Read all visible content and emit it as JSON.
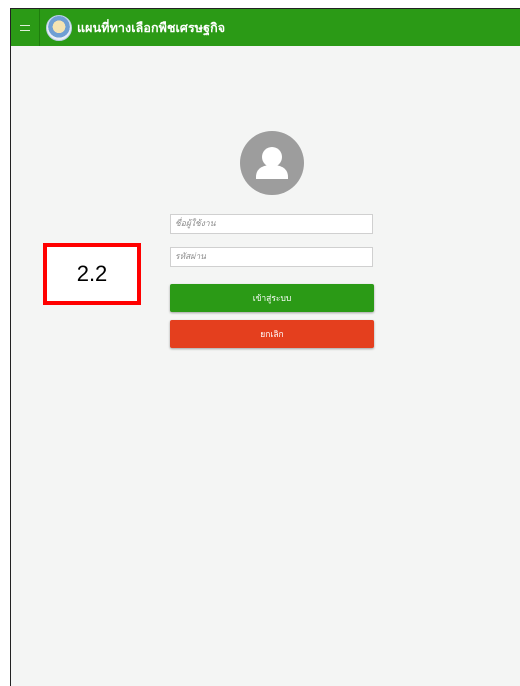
{
  "app": {
    "title": "แผนที่ทางเลือกพืชเศรษฐกิจ"
  },
  "login": {
    "username_placeholder": "ชื่อผู้ใช้งาน",
    "password_placeholder": "รหัสผ่าน",
    "login_label": "เข้าสู่ระบบ",
    "cancel_label": "ยกเลิก"
  },
  "annotation": {
    "label": "2.2"
  },
  "colors": {
    "primary": "#2b9a16",
    "danger": "#e43f1e",
    "annotation_border": "#ff0000",
    "background": "#f4f5f4"
  },
  "icons": {
    "menu": "hamburger-icon",
    "logo": "department-logo",
    "avatar": "user-avatar-icon"
  }
}
